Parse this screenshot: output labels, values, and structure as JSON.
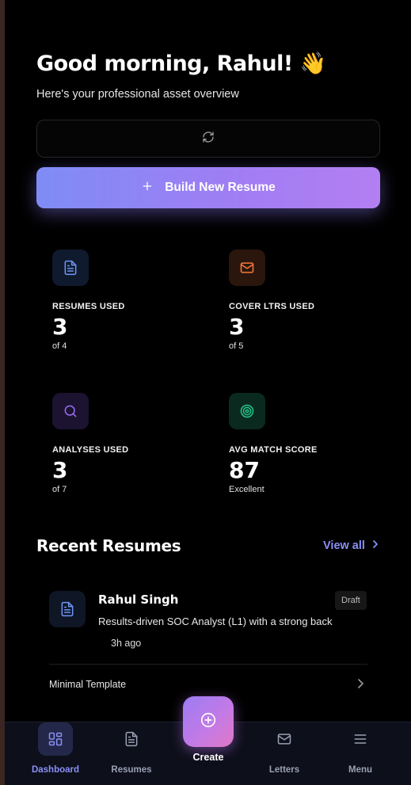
{
  "header": {
    "greeting": "Good morning, Rahul! 👋",
    "subtitle": "Here's your professional asset overview"
  },
  "actions": {
    "build_label": "Build New Resume"
  },
  "stats": [
    {
      "label": "RESUMES USED",
      "value": "3",
      "sub": "of 4",
      "icon": "document-icon",
      "color": "#3b82f6"
    },
    {
      "label": "COVER LTRS USED",
      "value": "3",
      "sub": "of 5",
      "icon": "mail-icon",
      "color": "#f97316"
    },
    {
      "label": "ANALYSES USED",
      "value": "3",
      "sub": "of 7",
      "icon": "search-icon",
      "color": "#8b5cf6"
    },
    {
      "label": "AVG MATCH SCORE",
      "value": "87",
      "sub": "Excellent",
      "icon": "target-icon",
      "color": "#10b981"
    }
  ],
  "recent": {
    "title": "Recent Resumes",
    "view_all": "View all",
    "items": [
      {
        "name": "Rahul Singh",
        "status": "Draft",
        "summary": "Results-driven SOC Analyst (L1) with a strong back",
        "time": "3h ago",
        "template": "Minimal Template"
      }
    ]
  },
  "nav": {
    "items": [
      {
        "label": "Dashboard",
        "icon": "dashboard-icon",
        "active": true
      },
      {
        "label": "Resumes",
        "icon": "document-icon"
      },
      {
        "label": "Create",
        "icon": "plus-circle-icon"
      },
      {
        "label": "Letters",
        "icon": "mail-icon"
      },
      {
        "label": "Menu",
        "icon": "menu-icon"
      }
    ]
  },
  "colors": {
    "accent": "#8b8ff6",
    "background": "#000000"
  }
}
